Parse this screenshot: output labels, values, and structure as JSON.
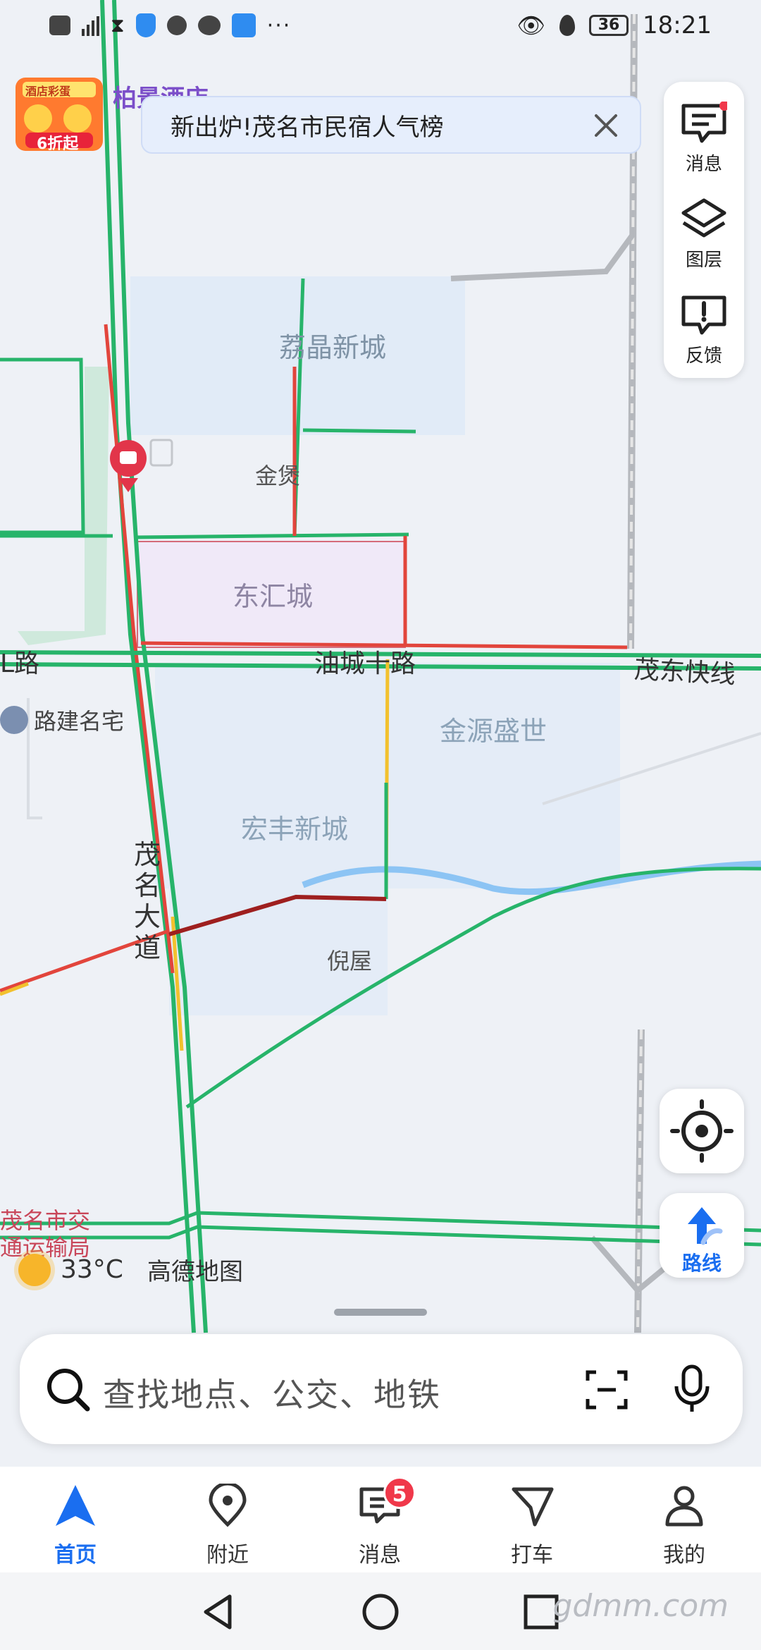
{
  "status_bar": {
    "left_icons": [
      "hd-icon",
      "signal-4g-icon",
      "hourglass-icon",
      "shield-icon",
      "profile-icon",
      "wechat-icon",
      "cloud-icon",
      "more-dots-icon"
    ],
    "battery": "36",
    "time": "18:21"
  },
  "promo": {
    "top_text": "酒店彩蛋",
    "discount": "6折起"
  },
  "hotel_label": "柏景酒店",
  "banner": {
    "text": "新出炉!茂名市民宿人气榜"
  },
  "side_panel": {
    "items": [
      {
        "label": "消息",
        "icon": "message-icon",
        "has_dot": true
      },
      {
        "label": "图层",
        "icon": "layers-icon"
      },
      {
        "label": "反馈",
        "icon": "feedback-icon"
      }
    ]
  },
  "map": {
    "places": {
      "lijing": "荔晶新城",
      "jinbao": "金煲",
      "donghui": "东汇城",
      "jinyuan": "金源盛世",
      "hongfeng": "宏丰新城",
      "niwu": "倪屋",
      "lujian": "路建名宅",
      "traffic_bureau_1": "茂名市交",
      "traffic_bureau_2": "通运输局"
    },
    "roads": {
      "road_left": "L路",
      "youcheng": "油城十路",
      "maodong": "茂东快线",
      "maoming_dadao": [
        "茂",
        "名",
        "大",
        "道"
      ]
    },
    "weather": {
      "temp": "33°C",
      "icon": "sun-icon"
    },
    "brand": "高德地图"
  },
  "fab": {
    "locate_icon": "locate-icon",
    "route_label": "路线"
  },
  "search": {
    "placeholder": "查找地点、公交、地铁"
  },
  "tabs": [
    {
      "label": "首页",
      "icon": "home-arrow-icon",
      "active": true
    },
    {
      "label": "附近",
      "icon": "location-pin-icon"
    },
    {
      "label": "消息",
      "icon": "message-icon",
      "badge": "5"
    },
    {
      "label": "打车",
      "icon": "taxi-icon"
    },
    {
      "label": "我的",
      "icon": "user-icon"
    }
  ],
  "nav": {
    "watermark": "gdmm.com"
  },
  "colors": {
    "accent": "#1a6ef0",
    "road_green": "#27b46a",
    "road_red": "#e2453c",
    "road_yellow": "#f2c12e"
  }
}
